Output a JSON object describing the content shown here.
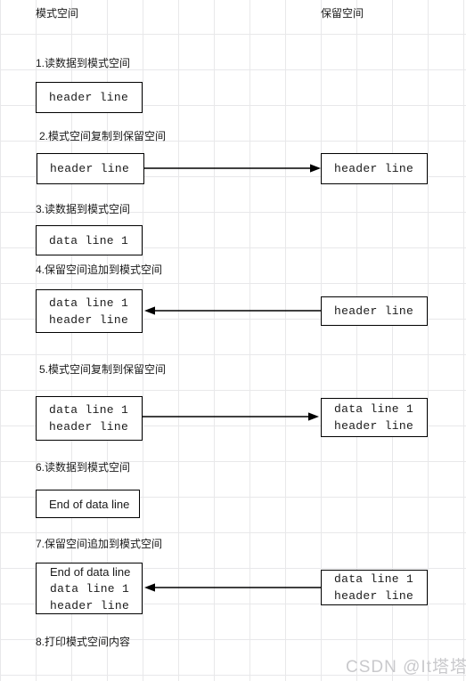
{
  "columns": {
    "left_title": "模式空间",
    "right_title": "保留空间"
  },
  "steps": [
    {
      "id": 1,
      "label": "1.读数据到模式空间",
      "left_box": {
        "lines": [
          "header line"
        ],
        "fonts": [
          "mono"
        ]
      },
      "right_box": null,
      "arrow": null
    },
    {
      "id": 2,
      "label": "2.模式空间复制到保留空间",
      "left_box": {
        "lines": [
          "header line"
        ],
        "fonts": [
          "mono"
        ]
      },
      "right_box": {
        "lines": [
          "header line"
        ],
        "fonts": [
          "mono"
        ]
      },
      "arrow": "right"
    },
    {
      "id": 3,
      "label": "3.读数据到模式空间",
      "left_box": {
        "lines": [
          "data line 1"
        ],
        "fonts": [
          "mono"
        ]
      },
      "right_box": null,
      "arrow": null
    },
    {
      "id": 4,
      "label": "4.保留空间追加到模式空间",
      "left_box": {
        "lines": [
          "data line 1",
          "header line"
        ],
        "fonts": [
          "mono",
          "mono"
        ]
      },
      "right_box": {
        "lines": [
          "header line"
        ],
        "fonts": [
          "mono"
        ]
      },
      "arrow": "left"
    },
    {
      "id": 5,
      "label": "5.模式空间复制到保留空间",
      "left_box": {
        "lines": [
          "data line 1",
          "header line"
        ],
        "fonts": [
          "mono",
          "mono"
        ]
      },
      "right_box": {
        "lines": [
          "data line 1",
          "header line"
        ],
        "fonts": [
          "mono",
          "mono"
        ]
      },
      "arrow": "right"
    },
    {
      "id": 6,
      "label": "6.读数据到模式空间",
      "left_box": {
        "lines": [
          "End of data line"
        ],
        "fonts": [
          "sans"
        ]
      },
      "right_box": null,
      "arrow": null
    },
    {
      "id": 7,
      "label": "7.保留空间追加到模式空间",
      "left_box": {
        "lines": [
          "End of data line",
          "data line 1",
          "header line"
        ],
        "fonts": [
          "sans",
          "mono",
          "mono"
        ]
      },
      "right_box": {
        "lines": [
          "data line 1",
          "header line"
        ],
        "fonts": [
          "mono",
          "mono"
        ]
      },
      "arrow": "left"
    },
    {
      "id": 8,
      "label": "8.打印模式空间内容",
      "left_box": null,
      "right_box": null,
      "arrow": null
    }
  ],
  "watermark": "CSDN @It塔塔开",
  "colors": {
    "grid": "#e8e8ea",
    "box_border": "#000000",
    "text": "#1a1a1a",
    "watermark": "#c9c9cc"
  }
}
